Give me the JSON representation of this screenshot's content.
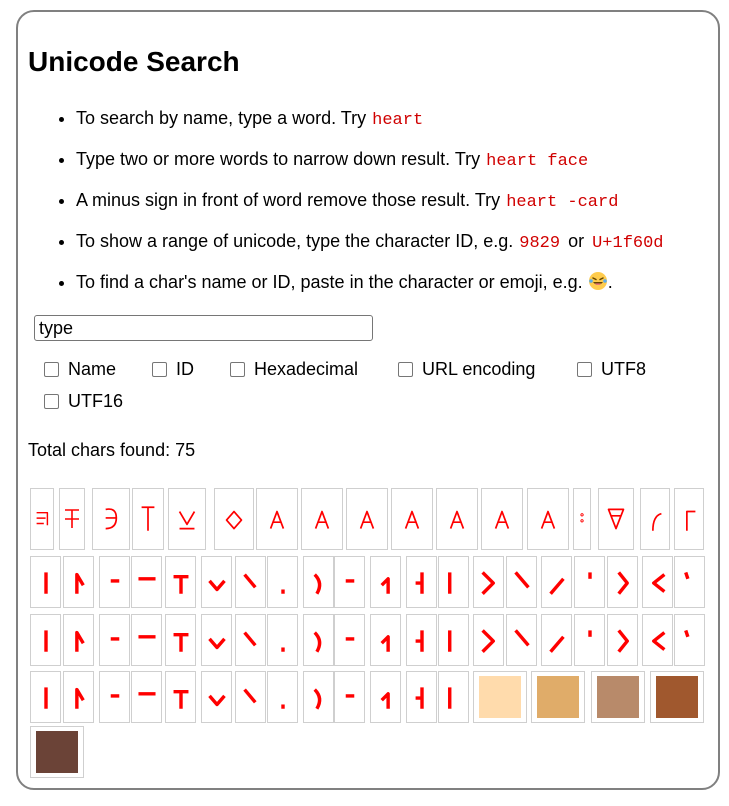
{
  "title": "Unicode Search",
  "tips": [
    {
      "text": "To search by name, type a word. Try",
      "code1": "heart"
    },
    {
      "text": "Type two or more words to narrow down result. Try",
      "code1": "heart face"
    },
    {
      "text": "A minus sign in front of word remove those result. Try",
      "code1": "heart -card"
    },
    {
      "text": "To show a range of unicode, type the character ID, e.g.",
      "code1": "9829",
      "mid": "or",
      "code2": "U+1f60d"
    },
    {
      "text": "To find a char's name or ID, paste in the character or emoji, e.g.",
      "emoji": "laughing-face-emoji",
      "end": "."
    }
  ],
  "search": {
    "value": "type"
  },
  "options": [
    "Name",
    "ID",
    "Hexadecimal",
    "URL encoding",
    "UTF8",
    "UTF16"
  ],
  "total_label": "Total chars found: 75",
  "colors": {
    "glyph": "#ff0000",
    "border": "#808080",
    "code": "#d00000"
  },
  "skin_tones": [
    "#ffdbac",
    "#e0ac69",
    "#b88a6a",
    "#a0582e",
    "#6b4337"
  ]
}
